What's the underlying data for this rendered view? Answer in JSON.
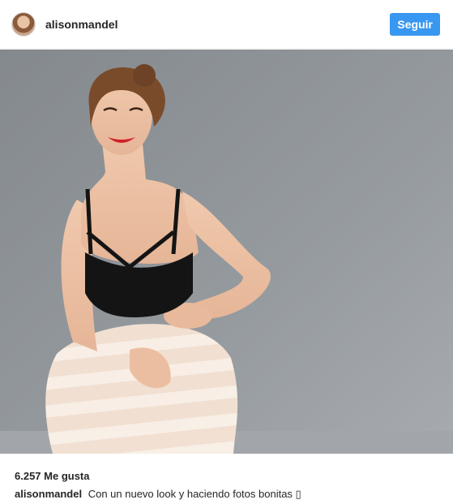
{
  "header": {
    "username": "alisonmandel",
    "follow_label": "Seguir",
    "follow_color": "#3897f0"
  },
  "photo": {
    "description_icon": "portrait-photo"
  },
  "footer": {
    "likes": "6.257 Me gusta",
    "caption_user": "alisonmandel",
    "caption_text": "Con un nuevo look y haciendo fotos bonitas ▯"
  }
}
